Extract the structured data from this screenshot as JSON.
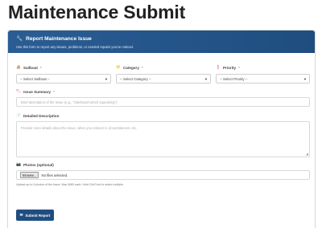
{
  "page": {
    "title": "Maintenance Submit"
  },
  "card": {
    "title": "Report Maintenance Issue",
    "subtitle": "Use this form to report any issues, problems, or needed repairs you've noticed."
  },
  "fields": {
    "sailboat": {
      "label": "Sailboat",
      "required": "*",
      "value": "-- Select Sailboat --"
    },
    "category": {
      "label": "Category",
      "required": "*",
      "value": "-- Select Category --"
    },
    "priority": {
      "label": "Priority",
      "required": "*",
      "value": "-- Select Priority --"
    },
    "summary": {
      "label": "Issue Summary",
      "required": "*",
      "placeholder": "Brief description of the issue (e.g., \"Starboard winch squeaking\")"
    },
    "description": {
      "label": "Detailed Description",
      "placeholder": "Provide more details about the issue, when you noticed it, circumstances, etc."
    },
    "photos": {
      "label": "Photos (optional)",
      "browse_label": "Browse...",
      "file_status": "No files selected.",
      "help": "Upload up to 5 photos of the issue. Max 5MB each. Hold Ctrl/Cmd to select multiple."
    }
  },
  "submit": {
    "label": "Submit Report"
  }
}
